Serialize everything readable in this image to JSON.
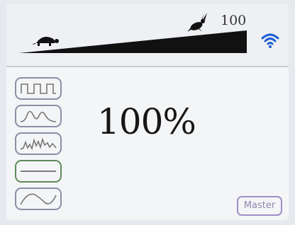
{
  "speed": {
    "max_label": "100",
    "level": 1.0,
    "slow_icon": "turtle-icon",
    "fast_icon": "rabbit-icon"
  },
  "status": {
    "wifi_icon": "wifi-icon",
    "wifi_color": "#1e5fd6"
  },
  "display": {
    "value": "100%"
  },
  "waveforms": [
    {
      "name": "square-wave",
      "selected": false
    },
    {
      "name": "sine-wave",
      "selected": false
    },
    {
      "name": "random-wave",
      "selected": false
    },
    {
      "name": "flat-wave",
      "selected": true
    },
    {
      "name": "ramp-wave",
      "selected": false
    }
  ],
  "mode_button": {
    "label": "Master"
  },
  "colors": {
    "selected_border": "#5f8a5b",
    "button_border": "#8b8fa6",
    "mode_border": "#9f8fc9"
  }
}
